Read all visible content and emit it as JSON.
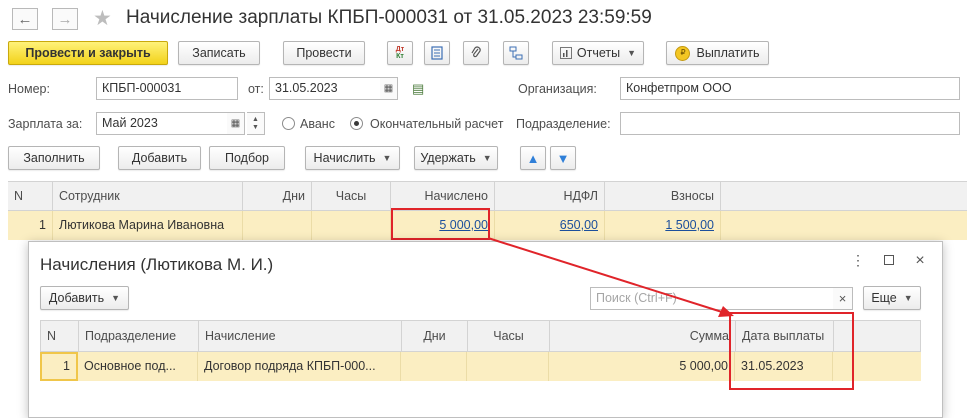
{
  "window": {
    "title": "Начисление зарплаты КПБП-000031 от 31.05.2023 23:59:59",
    "nav_back_icon": "arrow-left-icon",
    "nav_forward_icon": "arrow-right-icon",
    "favorite_icon": "star-icon"
  },
  "toolbar": {
    "post_and_close": "Провести и закрыть",
    "save": "Записать",
    "post": "Провести",
    "dt_kt_icon": "Дт\nКт",
    "reports": "Отчеты",
    "pay": "Выплатить"
  },
  "form": {
    "number_label": "Номер:",
    "number_value": "КПБП-000031",
    "date_label": "от:",
    "date_value": "31.05.2023",
    "organization_label": "Организация:",
    "organization_value": "Конфетпром ООО",
    "salary_for_label": "Зарплата за:",
    "salary_for_value": "Май 2023",
    "advance_label": "Аванс",
    "final_label": "Окончательный расчет",
    "final_selected": true,
    "department_label": "Подразделение:",
    "department_value": ""
  },
  "actions": {
    "fill": "Заполнить",
    "add": "Добавить",
    "select": "Подбор",
    "accrue": "Начислить",
    "withhold": "Удержать"
  },
  "main_table": {
    "columns": [
      "N",
      "Сотрудник",
      "Дни",
      "Часы",
      "Начислено",
      "НДФЛ",
      "Взносы"
    ],
    "rows": [
      {
        "n": "1",
        "employee": "Лютикова Марина Ивановна",
        "days": "",
        "hours": "",
        "accrued": "5 000,00",
        "ndfl": "650,00",
        "contrib": "1 500,00"
      }
    ]
  },
  "popup": {
    "title": "Начисления (Лютикова М. И.)",
    "add": "Добавить",
    "search_placeholder": "Поиск (Ctrl+F)",
    "more": "Еще",
    "columns": [
      "N",
      "Подразделение",
      "Начисление",
      "Дни",
      "Часы",
      "Сумма",
      "Дата выплаты"
    ],
    "rows": [
      {
        "n": "1",
        "department": "Основное под...",
        "accrual": "Договор подряда КПБП-000...",
        "days": "",
        "hours": "",
        "sum": "5 000,00",
        "pay_date": "31.05.2023"
      }
    ]
  },
  "colors": {
    "primary_button": "#f2d21a",
    "selected_row": "#fbeec2",
    "link": "#1c4f9c",
    "annotation_red": "#e0242a"
  }
}
